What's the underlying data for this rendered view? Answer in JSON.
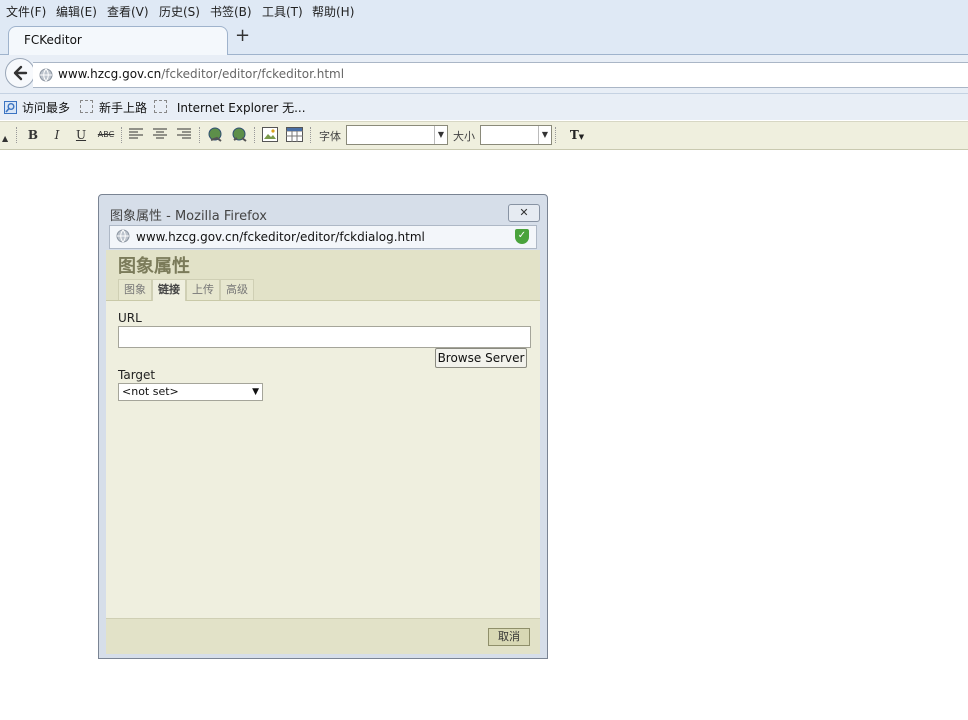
{
  "menubar": {
    "items": [
      "文件(F)",
      "编辑(E)",
      "查看(V)",
      "历史(S)",
      "书签(B)",
      "工具(T)",
      "帮助(H)"
    ]
  },
  "tab": {
    "title": "FCKeditor",
    "new_tab": "+"
  },
  "url": {
    "host": "www.hzcg.gov.cn",
    "path": "/fckeditor/editor/fckeditor.html"
  },
  "bookmarks": [
    "访问最多",
    "新手上路",
    "Internet Explorer 无..."
  ],
  "fck_toolbar": {
    "bold": "B",
    "italic": "I",
    "underline": "U",
    "strike": "ABC",
    "font_label": "字体",
    "size_label": "大小",
    "color": "T"
  },
  "dialog": {
    "window_title": "图象属性 - Mozilla Firefox",
    "url": "www.hzcg.gov.cn/fckeditor/editor/fckdialog.html",
    "heading": "图象属性",
    "tabs": [
      "图象",
      "链接",
      "上传",
      "高级"
    ],
    "active_tab": "链接",
    "url_label": "URL",
    "url_value": "",
    "browse_button": "Browse Server",
    "target_label": "Target",
    "target_value": "<not set>",
    "cancel_button": "取消"
  }
}
